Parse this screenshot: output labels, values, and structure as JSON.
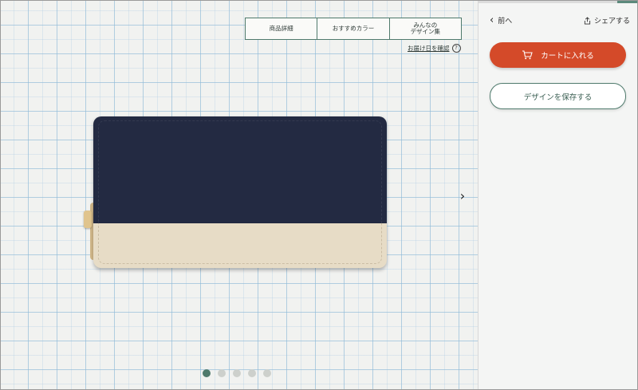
{
  "tabs": [
    {
      "label_line1": "商品詳細",
      "label_line2": ""
    },
    {
      "label_line1": "おすすめカラー",
      "label_line2": ""
    },
    {
      "label_line1": "みんなの",
      "label_line2": "デザイン集"
    }
  ],
  "delivery_link": "お届け日を確認",
  "help_glyph": "?",
  "carousel": {
    "next_glyph": "›",
    "dot_count": 5,
    "active_index": 0
  },
  "product": {
    "top_color": "#232a42",
    "bottom_color": "#e7dcc6",
    "zipper_color": "#d3b98b"
  },
  "panel": {
    "back_label": "前へ",
    "back_glyph": "‹",
    "share_label": "シェアする",
    "cart_label": "カートに入れる",
    "save_label": "デザインを保存する"
  },
  "colors": {
    "accent": "#4f7a6c",
    "cart": "#d44a29"
  },
  "icons": [
    "chevron-left-icon",
    "share-icon",
    "cart-icon",
    "help-icon",
    "chevron-right-icon"
  ]
}
